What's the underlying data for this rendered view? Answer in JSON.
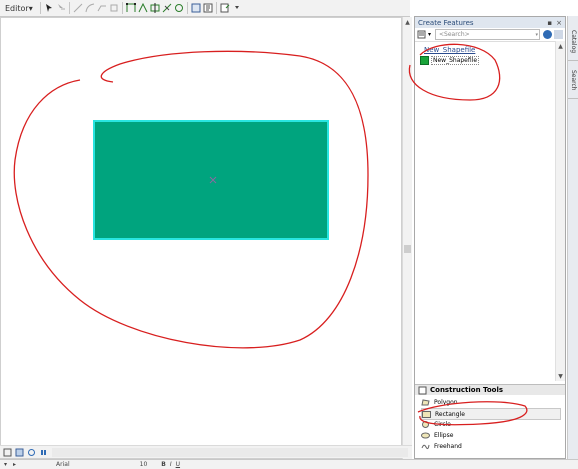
{
  "toolbar": {
    "editor_label": "Editor",
    "editor_menu_caret": "▾"
  },
  "panel": {
    "title": "Create Features",
    "search_placeholder": "<Search>",
    "group_header": "New_Shapefile",
    "template_label": "New_Shapefile",
    "template_color": "#19a43a"
  },
  "construction_tools": {
    "title": "Construction Tools",
    "items": [
      {
        "label": "Polygon"
      },
      {
        "label": "Rectangle"
      },
      {
        "label": "Circle"
      },
      {
        "label": "Ellipse"
      },
      {
        "label": "Freehand"
      }
    ],
    "selected": "Rectangle"
  },
  "side_tabs": {
    "catalog": "Catalog",
    "search": "Search"
  },
  "status": {
    "font_name": "Arial",
    "font_size": "10"
  },
  "colors": {
    "feature_fill": "#00a47e",
    "feature_outline": "#29e5e0",
    "annotation": "#d81f1f"
  }
}
